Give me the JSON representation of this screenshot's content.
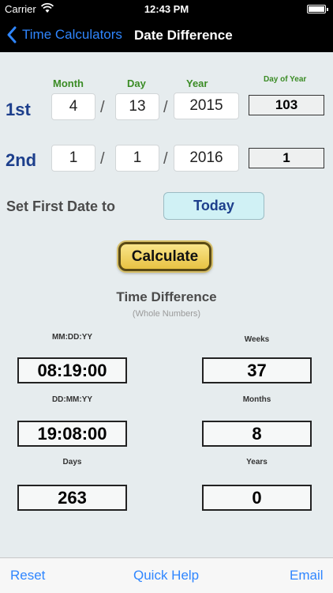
{
  "status_bar": {
    "carrier": "Carrier",
    "time": "12:43 PM"
  },
  "nav": {
    "back_label": "Time Calculators",
    "title": "Date Difference"
  },
  "headers": {
    "month": "Month",
    "day": "Day",
    "year": "Year",
    "day_of_year": "Day of Year"
  },
  "first_date": {
    "label": "1st",
    "month": "4",
    "day": "13",
    "year": "2015",
    "day_of_year": "103"
  },
  "second_date": {
    "label": "2nd",
    "month": "1",
    "day": "1",
    "year": "2016",
    "day_of_year": "1"
  },
  "separator": "/",
  "set_first": {
    "label": "Set First Date to",
    "button": "Today"
  },
  "calculate_label": "Calculate",
  "result": {
    "title": "Time Difference",
    "subtitle": "(Whole Numbers)",
    "mmddyy_label": "MM:DD:YY",
    "mmddyy": "08:19:00",
    "weeks_label": "Weeks",
    "weeks": "37",
    "ddmmyy_label": "DD:MM:YY",
    "ddmmyy": "19:08:00",
    "months_label": "Months",
    "months": "8",
    "days_label": "Days",
    "days": "263",
    "years_label": "Years",
    "years": "0"
  },
  "bottom": {
    "reset": "Reset",
    "quick_help": "Quick Help",
    "email": "Email"
  },
  "colors": {
    "accent": "#2f86ff",
    "green_label": "#3b8c25",
    "blue_label": "#1d3f8c"
  }
}
